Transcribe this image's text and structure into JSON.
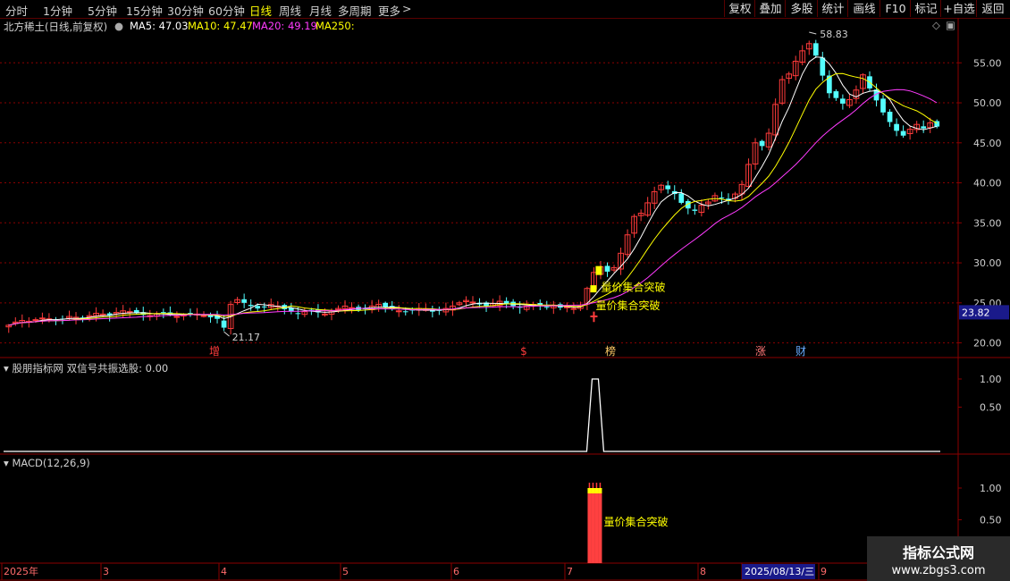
{
  "toolbar": {
    "periods": [
      "分时",
      "1分钟",
      "5分钟",
      "15分钟",
      "30分钟",
      "60分钟",
      "日线",
      "周线",
      "月线",
      "多周期",
      "更多"
    ],
    "active_period": "日线",
    "more_arrow": ">",
    "buttons": [
      "复权",
      "叠加",
      "多股",
      "统计",
      "画线",
      "F10",
      "标记",
      "+自选",
      "返回"
    ]
  },
  "main_header": {
    "stock": "北方稀土(日线,前复权)",
    "ma5": "MA5: 47.03",
    "ma10": "MA10: 47.47",
    "ma20": "MA20: 49.19",
    "ma250": "MA250:"
  },
  "panel2_header": {
    "title": "股朋指标网 双信号共振选股: 0.00"
  },
  "panel3_header": {
    "title": "MACD(12,26,9)"
  },
  "colors": {
    "up": "#ff3b3b",
    "down": "#54ffff",
    "ma5": "#ffffff",
    "ma10": "#ffff00",
    "ma20": "#ff3bff",
    "grid": "#8b0000",
    "signal": "#ffff00"
  },
  "price_axis": {
    "ticks": [
      "55.00",
      "50.00",
      "45.00",
      "40.00",
      "35.00",
      "30.00",
      "25.00",
      "20.00"
    ],
    "current_price": "23.82"
  },
  "signal_axis": {
    "ticks": [
      "1.00",
      "0.50"
    ]
  },
  "macd_axis": {
    "ticks": [
      "1.00",
      "0.50"
    ]
  },
  "date_axis": {
    "labels": [
      "2025年",
      "3",
      "4",
      "5",
      "6",
      "7",
      "8",
      "2025/08/13/三",
      "9"
    ]
  },
  "annotations": {
    "high": "58.83",
    "low": "21.17",
    "signal_text": "量价集合突破",
    "signal_text2": "量价集合突破",
    "macd_signal_text": "量价集合突破",
    "markers": [
      "增",
      "$",
      "榜",
      "涨",
      "财"
    ]
  },
  "watermark": {
    "line1": "指标公式网",
    "line2": "www.zbgs3.com"
  },
  "chart_data": {
    "type": "candlestick",
    "ylim": [
      18.5,
      59.5
    ],
    "close_series": [
      22.2,
      22.6,
      22.8,
      22.7,
      22.9,
      23.1,
      23.0,
      22.8,
      23.0,
      23.3,
      23.2,
      23.0,
      23.4,
      23.7,
      23.6,
      23.4,
      23.8,
      24.0,
      23.9,
      23.7,
      23.5,
      23.4,
      23.6,
      23.8,
      23.5,
      23.3,
      23.5,
      23.7,
      23.6,
      23.4,
      23.2,
      23.0,
      21.9,
      24.8,
      25.4,
      25.0,
      24.6,
      24.3,
      24.5,
      24.8,
      24.6,
      24.2,
      23.9,
      23.7,
      23.9,
      24.1,
      23.8,
      23.6,
      23.9,
      24.3,
      24.6,
      24.4,
      24.1,
      24.3,
      24.6,
      24.8,
      24.5,
      24.2,
      24.0,
      23.9,
      24.1,
      24.3,
      24.2,
      23.9,
      24.0,
      24.3,
      24.6,
      25.0,
      25.3,
      25.1,
      24.8,
      24.6,
      24.9,
      25.2,
      24.9,
      24.6,
      24.4,
      24.6,
      24.8,
      24.7,
      24.5,
      24.6,
      24.4,
      24.5,
      24.3,
      24.6,
      26.8,
      28.8,
      29.5,
      28.9,
      29.4,
      31.2,
      33.5,
      35.8,
      36.2,
      37.5,
      38.9,
      39.7,
      39.2,
      38.6,
      37.5,
      36.8,
      36.5,
      37.2,
      37.6,
      38.4,
      38.1,
      37.8,
      38.6,
      39.8,
      42.3,
      45.0,
      44.6,
      46.2,
      49.8,
      52.9,
      53.6,
      55.2,
      56.5,
      57.4,
      55.9,
      53.4,
      51.2,
      50.6,
      49.9,
      50.4,
      51.6,
      53.5,
      51.8,
      50.3,
      48.8,
      47.6,
      46.5,
      45.9,
      46.7,
      47.3,
      46.8,
      47.5,
      47.03
    ],
    "macd": {
      "signal_index": 87,
      "bars": [
        1.0,
        1.0,
        1.0,
        1.0
      ]
    },
    "signal_series": {
      "peak_index": 87,
      "peak": 1.0,
      "baseline": 0.0
    }
  }
}
